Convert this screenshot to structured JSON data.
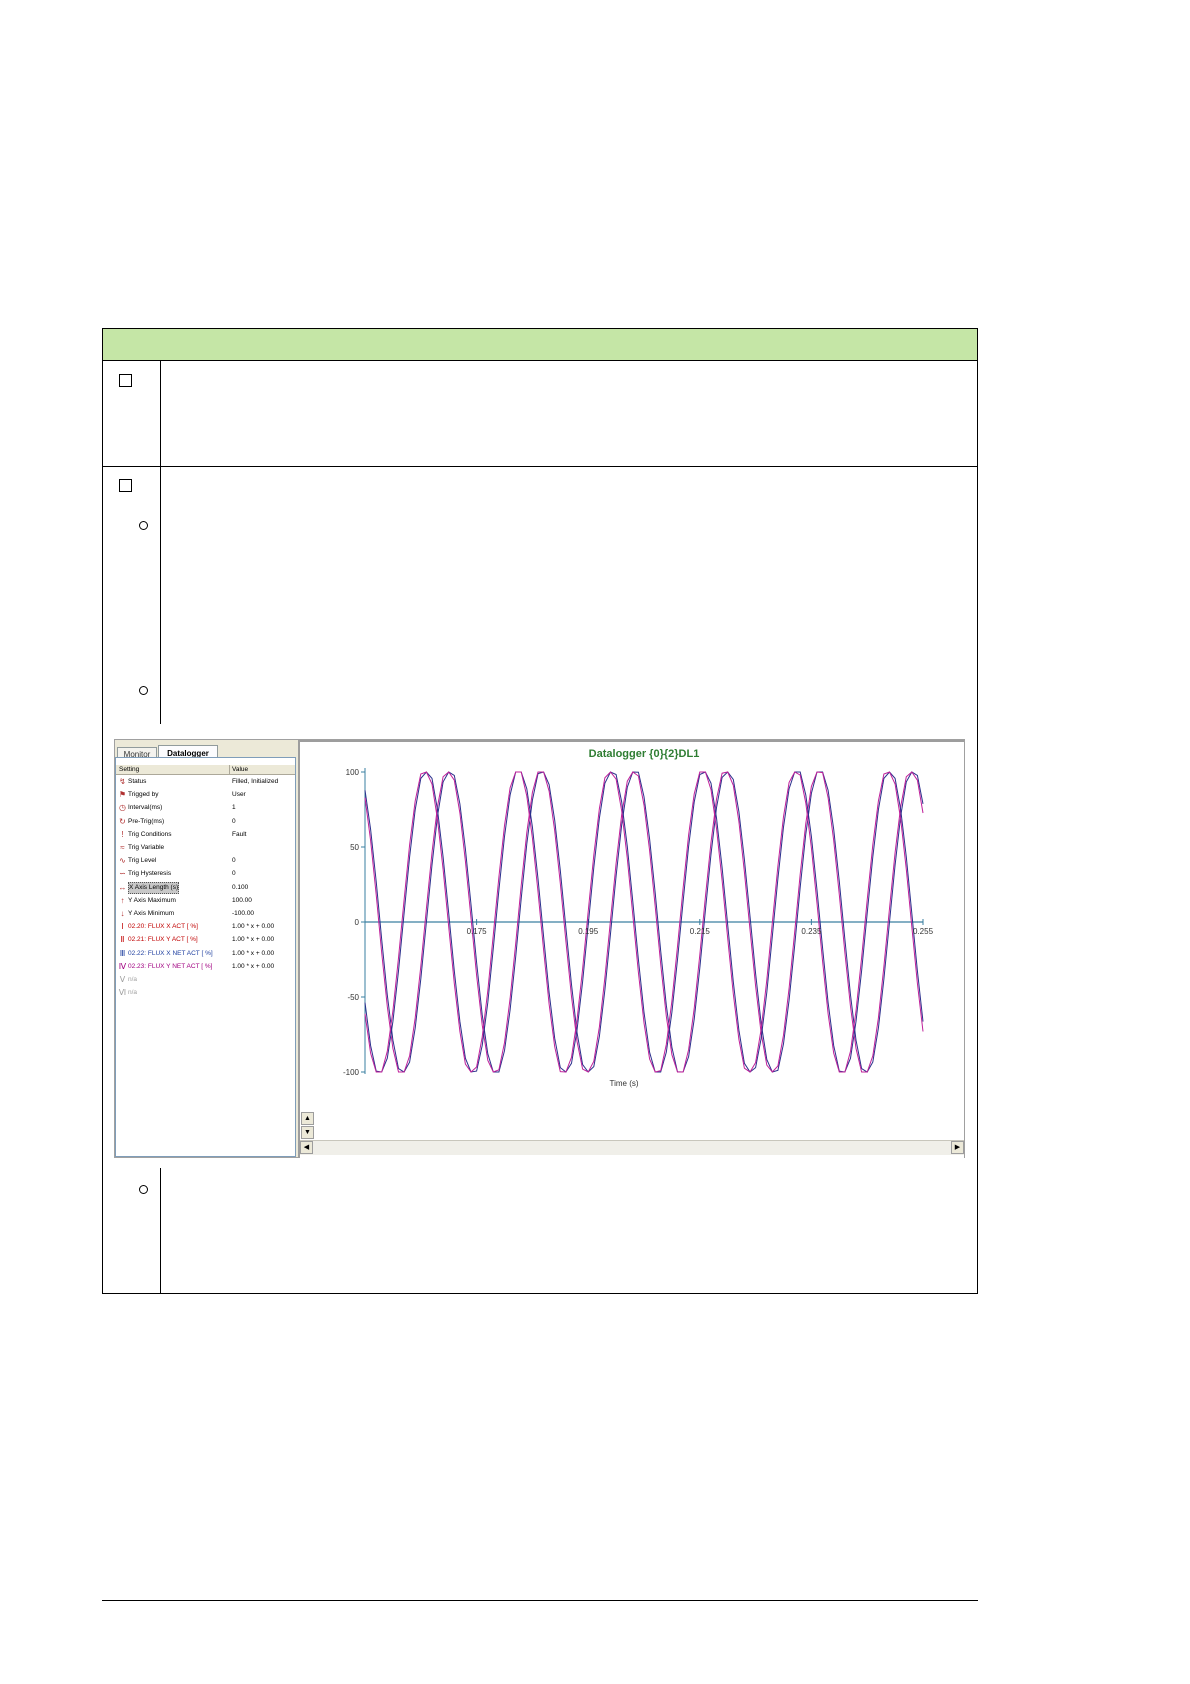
{
  "app": {
    "tabs": [
      {
        "label": "Monitor",
        "active": false
      },
      {
        "label": "Datalogger",
        "active": true
      }
    ],
    "grid": {
      "columns": [
        "Setting",
        "Value"
      ],
      "rows": [
        {
          "icon": "status-icon",
          "label": "Status",
          "value": "Filled, Initialized",
          "color": "#000000"
        },
        {
          "icon": "trigger-icon",
          "label": "Trigged by",
          "value": "User",
          "color": "#000000"
        },
        {
          "icon": "clock-icon",
          "label": "Interval(ms)",
          "value": "1",
          "color": "#000000"
        },
        {
          "icon": "pretrig-icon",
          "label": "Pre-Trig(ms)",
          "value": "0",
          "color": "#000000"
        },
        {
          "icon": "exclamation-icon",
          "label": "Trig Conditions",
          "value": "Fault",
          "color": "#000000"
        },
        {
          "icon": "variable-icon",
          "label": "Trig Variable",
          "value": "",
          "color": "#000000"
        },
        {
          "icon": "level-icon",
          "label": "Trig Level",
          "value": "0",
          "color": "#000000"
        },
        {
          "icon": "hysteresis-icon",
          "label": "Trig Hysteresis",
          "value": "0",
          "color": "#000000"
        },
        {
          "icon": "x-axis-icon",
          "label": "X Axis Length (s)",
          "value": "0.100",
          "color": "#000000",
          "selected": true
        },
        {
          "icon": "arrow-up-icon",
          "label": "Y Axis Maximum",
          "value": "100.00",
          "color": "#000000"
        },
        {
          "icon": "arrow-down-icon",
          "label": "Y Axis Minimum",
          "value": "-100.00",
          "color": "#000000"
        },
        {
          "icon": "channel-1-icon",
          "label": "02.20: FLUX X ACT [   %]",
          "value": "1.00 * x + 0.00",
          "color": "#c00000"
        },
        {
          "icon": "channel-2-icon",
          "label": "02.21: FLUX Y ACT [   %]",
          "value": "1.00 * x + 0.00",
          "color": "#c00000"
        },
        {
          "icon": "channel-3-icon",
          "label": "02.22: FLUX X NET ACT [   %]",
          "value": "1.00 * x + 0.00",
          "color": "#2040a0"
        },
        {
          "icon": "channel-4-icon",
          "label": "02.23: FLUX Y NET ACT [   %]",
          "value": "1.00 * x + 0.00",
          "color": "#a00080"
        },
        {
          "icon": "channel-5-icon",
          "label": "n/a",
          "value": "",
          "color": "#a0a0a0"
        },
        {
          "icon": "channel-6-icon",
          "label": "n/a",
          "value": "",
          "color": "#a0a0a0"
        }
      ]
    }
  },
  "colors": {
    "title": "#2e7d32",
    "series_blue": "#2b2f8c",
    "series_magenta": "#c0209a",
    "axis": "#3a7fa0"
  },
  "chart_data": {
    "type": "line",
    "title": "Datalogger {0}{2}DL1",
    "xlabel": "Time (s)",
    "ylabel": "",
    "xlim": [
      0.155,
      0.255
    ],
    "ylim": [
      -100,
      100
    ],
    "x_ticks": [
      "0.175",
      "0.195",
      "0.215",
      "0.235",
      "0.255"
    ],
    "y_ticks": [
      "100",
      "50",
      "0",
      "-50",
      "-100"
    ],
    "period_s": 0.0166,
    "series": [
      {
        "amplitude": 100,
        "phase_deg": 0,
        "color": "#2b2f8c"
      },
      {
        "amplitude": 100,
        "phase_deg": 5,
        "color": "#c0209a"
      },
      {
        "amplitude": 100,
        "phase_deg": 90,
        "color": "#2b2f8c"
      },
      {
        "amplitude": 100,
        "phase_deg": 95,
        "color": "#c0209a"
      }
    ]
  }
}
